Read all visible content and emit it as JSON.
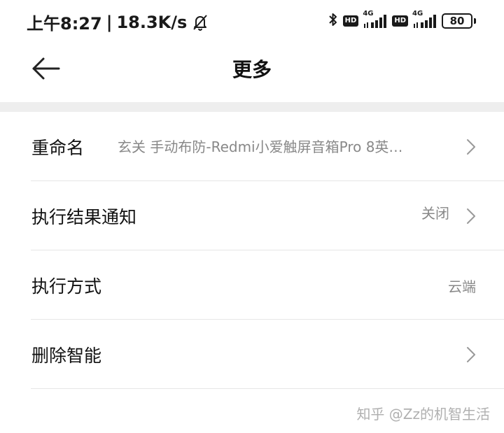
{
  "status_bar": {
    "time": "上午8:27",
    "separator": "|",
    "net_speed": "18.3K/s",
    "hd_label": "HD",
    "network_type": "4G",
    "battery_level": "80",
    "icons": [
      "bell-off-icon",
      "bluetooth-icon",
      "signal-icon",
      "battery-icon"
    ]
  },
  "header": {
    "title": "更多",
    "back_icon": "arrow-left-icon"
  },
  "settings": {
    "items": [
      {
        "label": "重命名",
        "value": "玄关 手动布防-Redmi小爱触屏音箱Pro 8英…",
        "has_chevron": true
      },
      {
        "label": "执行结果通知",
        "value": "关闭",
        "has_chevron": true
      },
      {
        "label": "执行方式",
        "value": "云端",
        "has_chevron": false
      },
      {
        "label": "删除智能",
        "value": "",
        "has_chevron": true
      }
    ]
  },
  "watermark": "知乎 @Zz的机智生活",
  "colors": {
    "background": "#ffffff",
    "divider": "#eeeeee",
    "secondary_text": "#888888"
  }
}
